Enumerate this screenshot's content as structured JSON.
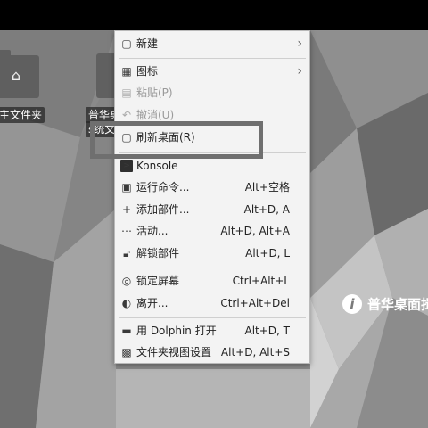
{
  "desktop": {
    "icons": [
      {
        "label": "主文件夹",
        "icon": "home-folder-icon"
      },
      {
        "label": "普华桌",
        "label2": "s统文"
      }
    ],
    "brand": "普华桌面揖",
    "colors": {
      "menu_bg": "#f3f3f3",
      "topbar": "#000000",
      "highlight_box": "#6f6f6f"
    }
  },
  "menu": {
    "items": [
      {
        "label": "新建",
        "icon": "new-document-icon",
        "submenu": true
      },
      {
        "label": "图标",
        "icon": "icons-grid-icon",
        "submenu": true
      },
      {
        "label": "粘贴(P)",
        "icon": "paste-icon",
        "disabled": true
      },
      {
        "label": "撤消(U)",
        "icon": "undo-icon",
        "disabled": true
      },
      {
        "label": "刷新桌面(R)",
        "icon": "refresh-icon"
      },
      {
        "label": "Konsole",
        "icon": "terminal-icon"
      },
      {
        "label": "运行命令...",
        "icon": "run-command-icon",
        "shortcut": "Alt+空格"
      },
      {
        "label": "添加部件...",
        "icon": "plus-icon",
        "shortcut": "Alt+D, A"
      },
      {
        "label": "活动...",
        "icon": "activities-icon",
        "shortcut": "Alt+D, Alt+A"
      },
      {
        "label": "解锁部件",
        "icon": "unlock-icon",
        "shortcut": "Alt+D, L"
      },
      {
        "label": "锁定屏幕",
        "icon": "lock-screen-icon",
        "shortcut": "Ctrl+Alt+L"
      },
      {
        "label": "离开...",
        "icon": "leave-icon",
        "shortcut": "Ctrl+Alt+Del"
      },
      {
        "label": "用 Dolphin 打开",
        "icon": "dolphin-icon",
        "shortcut": "Alt+D, T"
      },
      {
        "label": "文件夹视图设置",
        "icon": "folder-view-settings-icon",
        "shortcut": "Alt+D, Alt+S"
      }
    ]
  }
}
